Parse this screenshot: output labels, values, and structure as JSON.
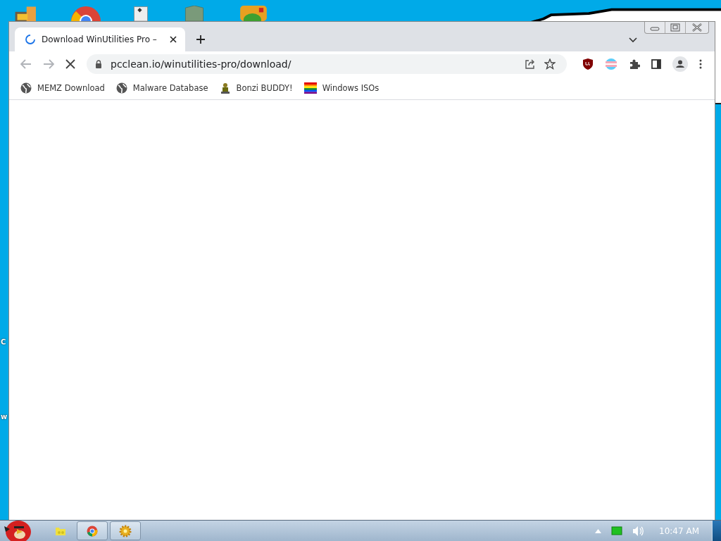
{
  "desktop": {
    "edge_labels": [
      "C",
      "w"
    ]
  },
  "browser": {
    "tabs": [
      {
        "title": "Download WinUtilities Pro –",
        "selected": true
      }
    ],
    "loading": true,
    "address": "pcclean.io/winutilities-pro/download/",
    "bookmarks": [
      {
        "label": "MEMZ Download",
        "kind": "globe"
      },
      {
        "label": "Malware Database",
        "kind": "globe"
      },
      {
        "label": "Bonzi BUDDY!",
        "kind": "figure"
      },
      {
        "label": "Windows ISOs",
        "kind": "rainbow"
      }
    ]
  },
  "taskbar": {
    "buttons": [
      {
        "kind": "folder",
        "open": false
      },
      {
        "kind": "chrome",
        "open": true
      },
      {
        "kind": "gear",
        "open": true
      }
    ],
    "clock": "10:47 AM"
  }
}
